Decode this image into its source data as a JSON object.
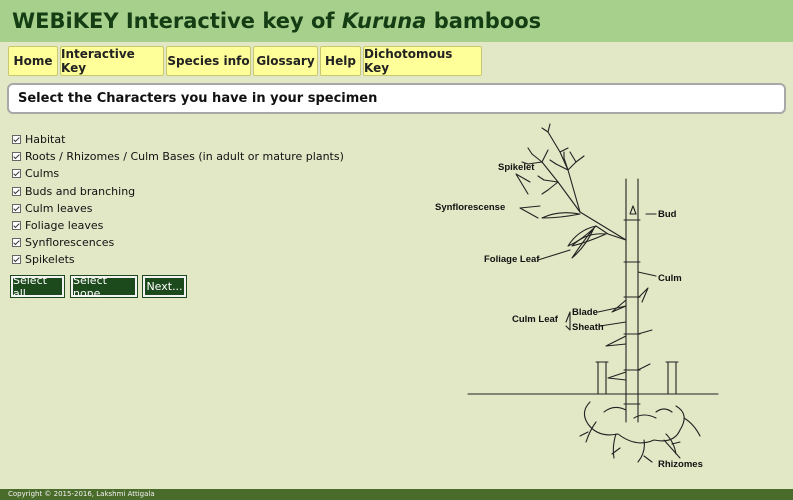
{
  "header": {
    "title_prefix": "WEBiKEY Interactive key of ",
    "title_italic": "Kuruna",
    "title_suffix": " bamboos"
  },
  "nav": {
    "tabs": [
      "Home",
      "Interactive Key",
      "Species info",
      "Glossary",
      "Help",
      "Dichotomous Key"
    ]
  },
  "prompt": "Select the Characters you have in your specimen",
  "characters": [
    {
      "label": "Habitat",
      "checked": true
    },
    {
      "label": "Roots / Rhizomes / Culm Bases (in adult or mature plants)",
      "checked": true
    },
    {
      "label": "Culms",
      "checked": true
    },
    {
      "label": "Buds and branching",
      "checked": true
    },
    {
      "label": "Culm leaves",
      "checked": true
    },
    {
      "label": "Foliage leaves",
      "checked": true
    },
    {
      "label": "Synflorescences",
      "checked": true
    },
    {
      "label": "Spikelets",
      "checked": true
    }
  ],
  "buttons": {
    "select_all": "Select all",
    "select_none": "Select none",
    "next": "Next..."
  },
  "illustration": {
    "labels": {
      "spikelet": "Spikelet",
      "synflorescense": "Synflorescense",
      "bud": "Bud",
      "foliage_leaf": "Foliage Leaf",
      "culm": "Culm",
      "blade": "Blade",
      "culm_leaf": "Culm Leaf",
      "sheath": "Sheath",
      "rhizomes": "Rhizomes"
    }
  },
  "footer": "Copyright © 2015-2016, Lakshmi Attigala"
}
